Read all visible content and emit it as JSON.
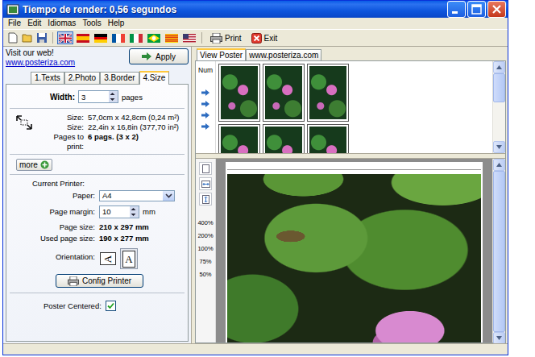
{
  "window": {
    "title": "Tiempo de render: 0,56 segundos"
  },
  "menu": [
    "File",
    "Edit",
    "Idiomas",
    "Tools",
    "Help"
  ],
  "toolbar": {
    "languages": [
      {
        "kind": "uk",
        "selected": true
      },
      {
        "kind": "es",
        "selected": false
      },
      {
        "kind": "de",
        "selected": false
      },
      {
        "kind": "fr",
        "selected": false
      },
      {
        "kind": "it",
        "selected": false
      },
      {
        "kind": "br",
        "selected": false
      },
      {
        "kind": "ca",
        "selected": false
      },
      {
        "kind": "us",
        "selected": false
      }
    ],
    "buttons": [
      {
        "label": "Print",
        "kind": "print"
      },
      {
        "label": "Exit",
        "kind": "exit"
      }
    ]
  },
  "sidebar": {
    "visit": "Visit our web!",
    "link": "www.posteriza.com",
    "apply": "Apply",
    "tabs": [
      {
        "label": "1.Texts",
        "selected": false
      },
      {
        "label": "2.Photo",
        "selected": false
      },
      {
        "label": "3.Border",
        "selected": false
      },
      {
        "label": "4.Size",
        "selected": true
      }
    ],
    "width": {
      "label": "Width:",
      "value": "3",
      "unit": "pages"
    },
    "sizes": [
      {
        "label": "Size:",
        "value": "57,0cm x 42,8cm (0,24 m²)"
      },
      {
        "label": "Size:",
        "value": "22,4in x 16,8in (377,70 in²)"
      }
    ],
    "pages_to_print": {
      "label": "Pages to print:",
      "value": "6 pags. (3 x 2)"
    },
    "more": "more",
    "current_printer": "Current Printer:",
    "paper": {
      "label": "Paper:",
      "value": "A4"
    },
    "margin": {
      "label": "Page margin:",
      "value": "10",
      "unit": "mm"
    },
    "page_size": {
      "label": "Page size:",
      "value": "210 x 297 mm"
    },
    "used_page_size": {
      "label": "Used page size:",
      "value": "190 x 277 mm"
    },
    "orientation": {
      "label": "Orientation:",
      "options": [
        {
          "kind": "landscape",
          "glyph": "A",
          "selected": false
        },
        {
          "kind": "portrait",
          "glyph": "A",
          "selected": true
        }
      ]
    },
    "config_printer": "Config Printer",
    "centered": {
      "label": "Poster Centered:",
      "checked": true
    }
  },
  "viewer": {
    "tabs": [
      {
        "label": "View Poster",
        "selected": true
      },
      {
        "label": "www.posteriza.com",
        "selected": false
      }
    ],
    "num_label": "Num",
    "thumbnails": {
      "columns": 3,
      "rows": 2
    },
    "zoom": [
      "400%",
      "200%",
      "100%",
      "75%",
      "50%"
    ]
  }
}
